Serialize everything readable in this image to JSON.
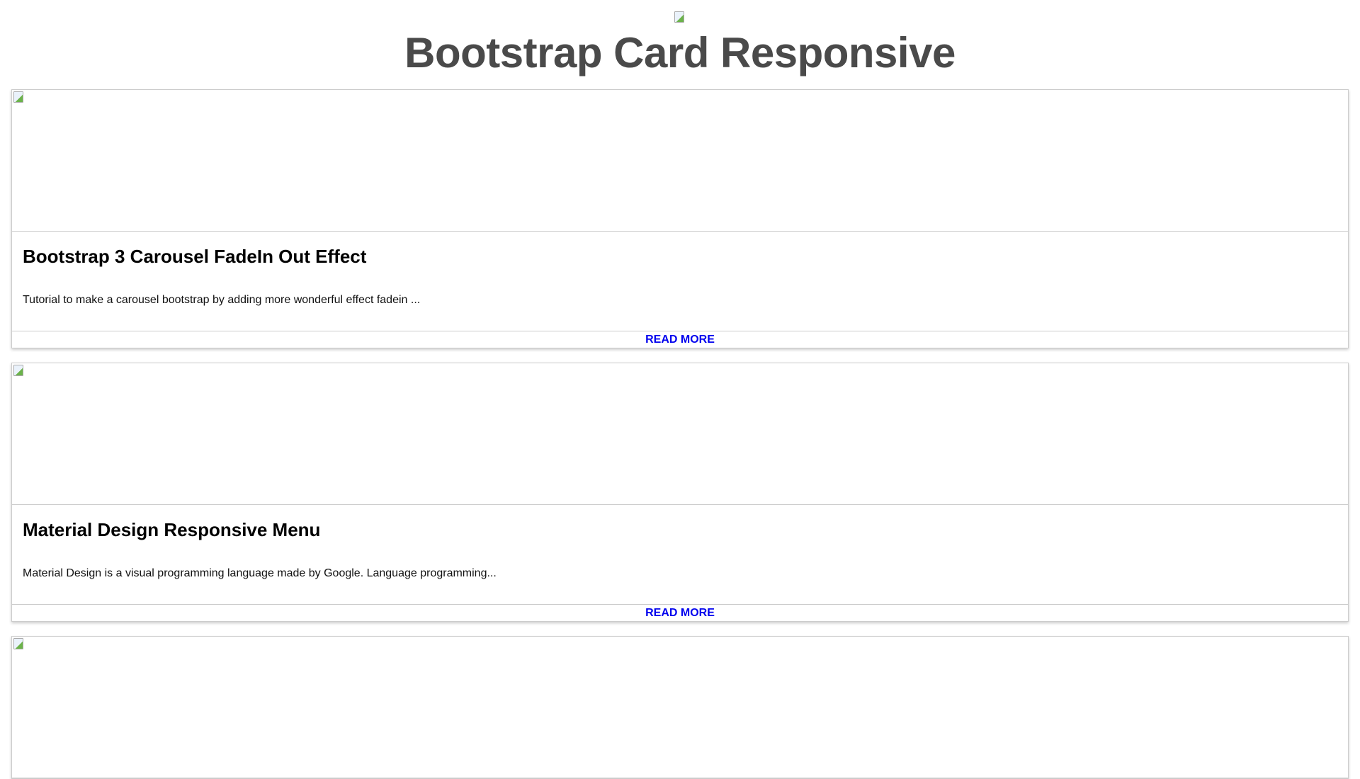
{
  "header": {
    "title": "Bootstrap Card Responsive",
    "logo_icon": "broken-image-icon"
  },
  "cards": [
    {
      "title": "Bootstrap 3 Carousel FadeIn Out Effect",
      "description": "Tutorial to make a carousel bootstrap by adding more wonderful effect fadein ...",
      "link": "READ MORE"
    },
    {
      "title": "Material Design Responsive Menu",
      "description": "Material Design is a visual programming language made by Google. Language programming...",
      "link": "READ MORE"
    },
    {
      "title": "",
      "description": "",
      "link": ""
    }
  ],
  "colors": {
    "title": "#4a4a4a",
    "link": "#0000ee",
    "border": "#cccccc"
  }
}
